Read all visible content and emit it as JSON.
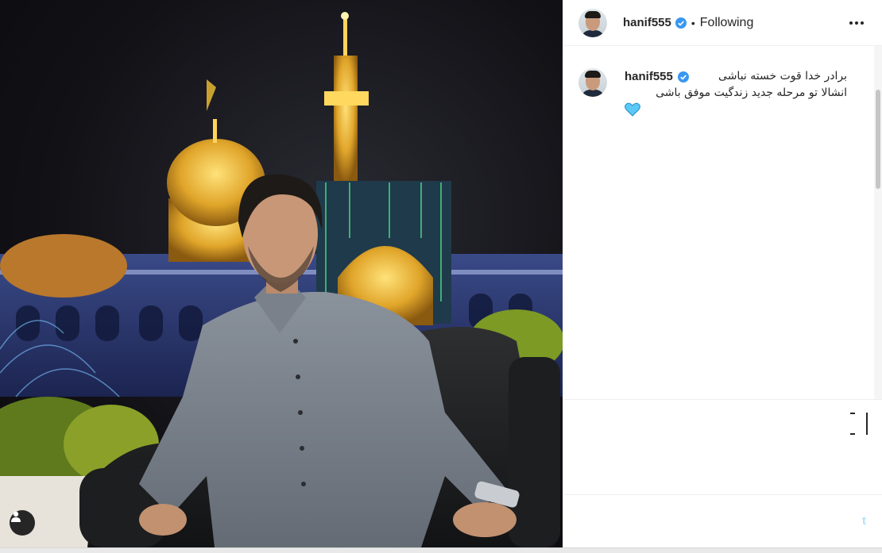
{
  "post": {
    "username": "hanif555",
    "follow_status": "Following",
    "separator": "•",
    "caption_line1": "برادر خدا قوت خسته نباشی",
    "caption_line2": "انشالا تو مرحله جدید زندگیت موفق باشی",
    "caption_emoji": "💙",
    "post_button_label": "t"
  },
  "icons": {
    "verified": "verified-badge-icon",
    "more": "more-options-icon",
    "user_tag": "user-tag-icon",
    "bookmark": "bookmark-icon"
  },
  "colors": {
    "verified_blue": "#3897f0",
    "text": "#262626",
    "border": "#efefef",
    "post_button": "#b2dffc"
  }
}
